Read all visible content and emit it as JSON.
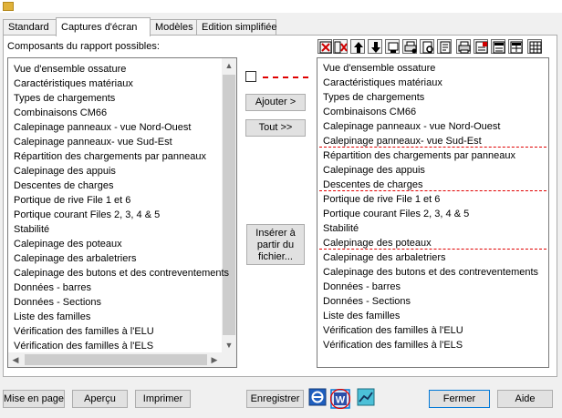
{
  "tabs": [
    {
      "label": "Standard"
    },
    {
      "label": "Captures d'écran"
    },
    {
      "label": "Modèles"
    },
    {
      "label": "Edition simplifiée"
    }
  ],
  "left_panel": {
    "label": "Composants du rapport possibles:",
    "items": [
      "Vue d'ensemble ossature",
      "Caractéristiques matériaux",
      "Types de chargements",
      "Combinaisons CM66",
      "Calepinage panneaux - vue Nord-Ouest",
      "Calepinage panneaux- vue Sud-Est",
      "Répartition des chargements par panneaux",
      "Calepinage des appuis",
      "Descentes de charges",
      "Portique de rive File 1 et 6",
      "Portique courant Files 2, 3, 4 & 5",
      "Stabilité",
      "Calepinage des poteaux",
      "Calepinage des arbaletriers",
      "Calepinage des butons et des contreventements",
      "Données - barres",
      "Données - Sections",
      "Liste des familles",
      "Vérification des familles à l'ELU",
      "Vérification des familles à l'ELS"
    ]
  },
  "middle": {
    "add_button": "Ajouter >",
    "all_button": "Tout >>",
    "insert_button": [
      "Insérer à",
      "partir du",
      "fichier..."
    ]
  },
  "right_panel": {
    "items": [
      "Vue d'ensemble ossature",
      "Caractéristiques matériaux",
      "Types de chargements",
      "Combinaisons CM66",
      "Calepinage panneaux - vue Nord-Ouest",
      "Calepinage panneaux- vue Sud-Est",
      "Répartition des chargements par panneaux",
      "Calepinage des appuis",
      "Descentes de charges",
      "Portique de rive File 1 et 6",
      "Portique courant Files 2, 3, 4 & 5",
      "Stabilité",
      "Calepinage des poteaux",
      "Calepinage des arbaletriers",
      "Calepinage des butons et des contreventements",
      "Données - barres",
      "Données - Sections",
      "Liste des familles",
      "Vérification des familles à l'ELU",
      "Vérification des familles à l'ELS"
    ]
  },
  "toolbar_icons": [
    "delete-icon",
    "delete-all-icon",
    "move-up-icon",
    "move-down-icon",
    "properties-icon",
    "print-settings-icon",
    "preview-icon",
    "page-icon",
    "printer-icon",
    "edit-icon",
    "header-icon",
    "layout-icon",
    "table-icon"
  ],
  "bottom": {
    "page_setup": "Mise en page",
    "preview": "Aperçu",
    "print": "Imprimer",
    "save": "Enregistrer",
    "close": "Fermer",
    "help": "Aide"
  },
  "colors": {
    "accent": "#e00000",
    "word_blue": "#2b4fa8",
    "selected_btn_border": "#0078d7"
  }
}
